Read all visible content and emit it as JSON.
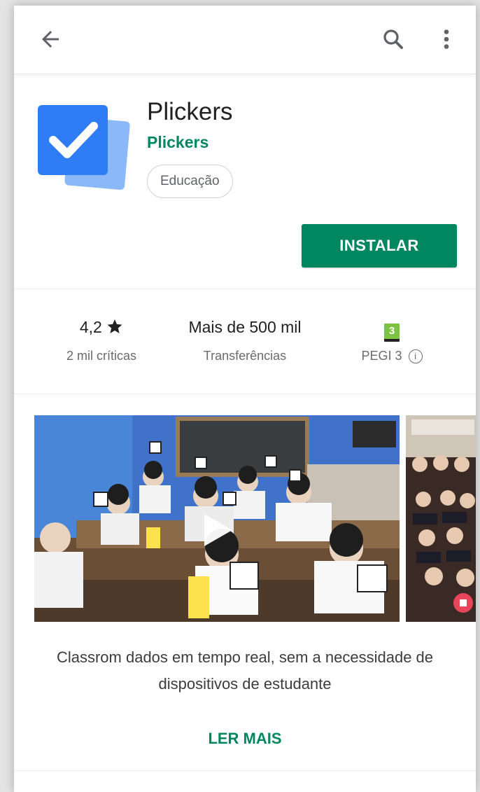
{
  "topbar": {
    "back_icon": "arrow-back-icon",
    "search_icon": "search-icon",
    "more_icon": "more-vert-icon"
  },
  "app": {
    "title": "Plickers",
    "developer": "Plickers",
    "category": "Educação",
    "install_label": "INSTALAR",
    "icon": "checkmark-app-icon"
  },
  "stats": {
    "rating": "4,2",
    "rating_icon": "star-icon",
    "reviews": "2 mil críticas",
    "downloads": "Mais de 500 mil",
    "downloads_label": "Transferências",
    "pegi_badge": "3",
    "pegi_label": "PEGI 3",
    "info_icon": "info-icon"
  },
  "media": {
    "video_thumbnail": "classroom-students-holding-cards",
    "play_icon": "play-icon",
    "screenshot": "students-holding-cards-screenshot"
  },
  "description": "Classrom dados em tempo real, sem a necessidade de dispositivos de estudante",
  "read_more_label": "LER MAIS",
  "colors": {
    "accent": "#01875f",
    "icon_blue": "#2e7cf6",
    "icon_blue_light": "#8bb8f8"
  }
}
